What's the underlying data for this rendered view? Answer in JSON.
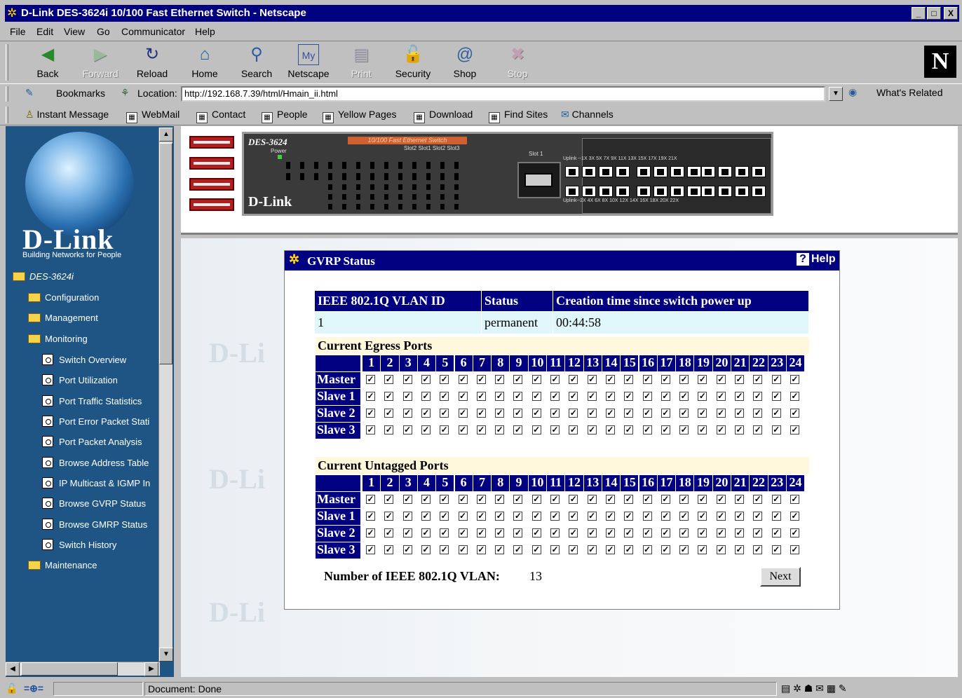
{
  "window": {
    "title": "D-Link DES-3624i 10/100 Fast Ethernet Switch - Netscape",
    "controls": [
      "_",
      "□",
      "X"
    ]
  },
  "menu": [
    "File",
    "Edit",
    "View",
    "Go",
    "Communicator",
    "Help"
  ],
  "nav_toolbar": [
    {
      "label": "Back",
      "icon": "back-arrow-icon",
      "enabled": true
    },
    {
      "label": "Forward",
      "icon": "forward-arrow-icon",
      "enabled": false
    },
    {
      "label": "Reload",
      "icon": "reload-icon",
      "enabled": true
    },
    {
      "label": "Home",
      "icon": "home-icon",
      "enabled": true
    },
    {
      "label": "Search",
      "icon": "search-icon",
      "enabled": true
    },
    {
      "label": "Netscape",
      "icon": "netscape-icon",
      "enabled": true
    },
    {
      "label": "Print",
      "icon": "print-icon",
      "enabled": false
    },
    {
      "label": "Security",
      "icon": "lock-icon",
      "enabled": true
    },
    {
      "label": "Shop",
      "icon": "shop-icon",
      "enabled": true
    },
    {
      "label": "Stop",
      "icon": "stop-icon",
      "enabled": false
    }
  ],
  "location_bar": {
    "bookmarks_label": "Bookmarks",
    "location_label": "Location:",
    "url": "http://192.168.7.39/html/Hmain_ii.html",
    "whats_related": "What's Related"
  },
  "personal_toolbar": [
    "Instant Message",
    "WebMail",
    "Contact",
    "People",
    "Yellow Pages",
    "Download",
    "Find Sites",
    "Channels"
  ],
  "sidebar": {
    "logo": "D-Link",
    "tagline": "Building Networks for People",
    "root": "DES-3624i",
    "folders": [
      "Configuration",
      "Management",
      "Monitoring"
    ],
    "monitoring_items": [
      "Switch Overview",
      "Port Utilization",
      "Port Traffic Statistics",
      "Port Error Packet Stati",
      "Port Packet Analysis",
      "Browse Address Table",
      "IP Multicast & IGMP In",
      "Browse GVRP Status",
      "Browse GMRP Status",
      "Switch History"
    ],
    "last_folder": "Maintenance"
  },
  "device": {
    "model": "DES-3624",
    "power_label": "Power",
    "banner": "10/100 Fast Ethernet Switch",
    "slot_labels": "Slot2 Slot1 Slot2 Slot3",
    "slot1_label": "Slot 1",
    "brand": "D-Link",
    "row_labels_top": "Uplink --1X  3X  5X  7X  9X  11X  13X  15X  17X  19X  21X",
    "row_labels_bottom": "Uplink--2X  4X  6X  8X  10X  12X  14X  16X  18X  20X  22X"
  },
  "gvrp": {
    "title": "GVRP Status",
    "help": "Help",
    "columns": [
      "IEEE 802.1Q VLAN ID",
      "Status",
      "Creation time since switch power up"
    ],
    "row": [
      "1",
      "permanent",
      "00:44:58"
    ],
    "egress_title": "Current Egress Ports",
    "untagged_title": "Current Untagged Ports",
    "ports": [
      "1",
      "2",
      "3",
      "4",
      "5",
      "6",
      "7",
      "8",
      "9",
      "10",
      "11",
      "12",
      "13",
      "14",
      "15",
      "16",
      "17",
      "18",
      "19",
      "20",
      "21",
      "22",
      "23",
      "24"
    ],
    "rows": [
      "Master",
      "Slave 1",
      "Slave 2",
      "Slave 3"
    ],
    "all_checked": true,
    "vlan_count_label": "Number of IEEE 802.1Q VLAN:",
    "vlan_count": "13",
    "next_label": "Next"
  },
  "status_bar": {
    "text": "Document: Done"
  },
  "colors": {
    "title_blue": "#000080",
    "sidebar_blue": "#1e5584",
    "row_cyan": "#dff6fb",
    "section_cream": "#fff8dc"
  }
}
